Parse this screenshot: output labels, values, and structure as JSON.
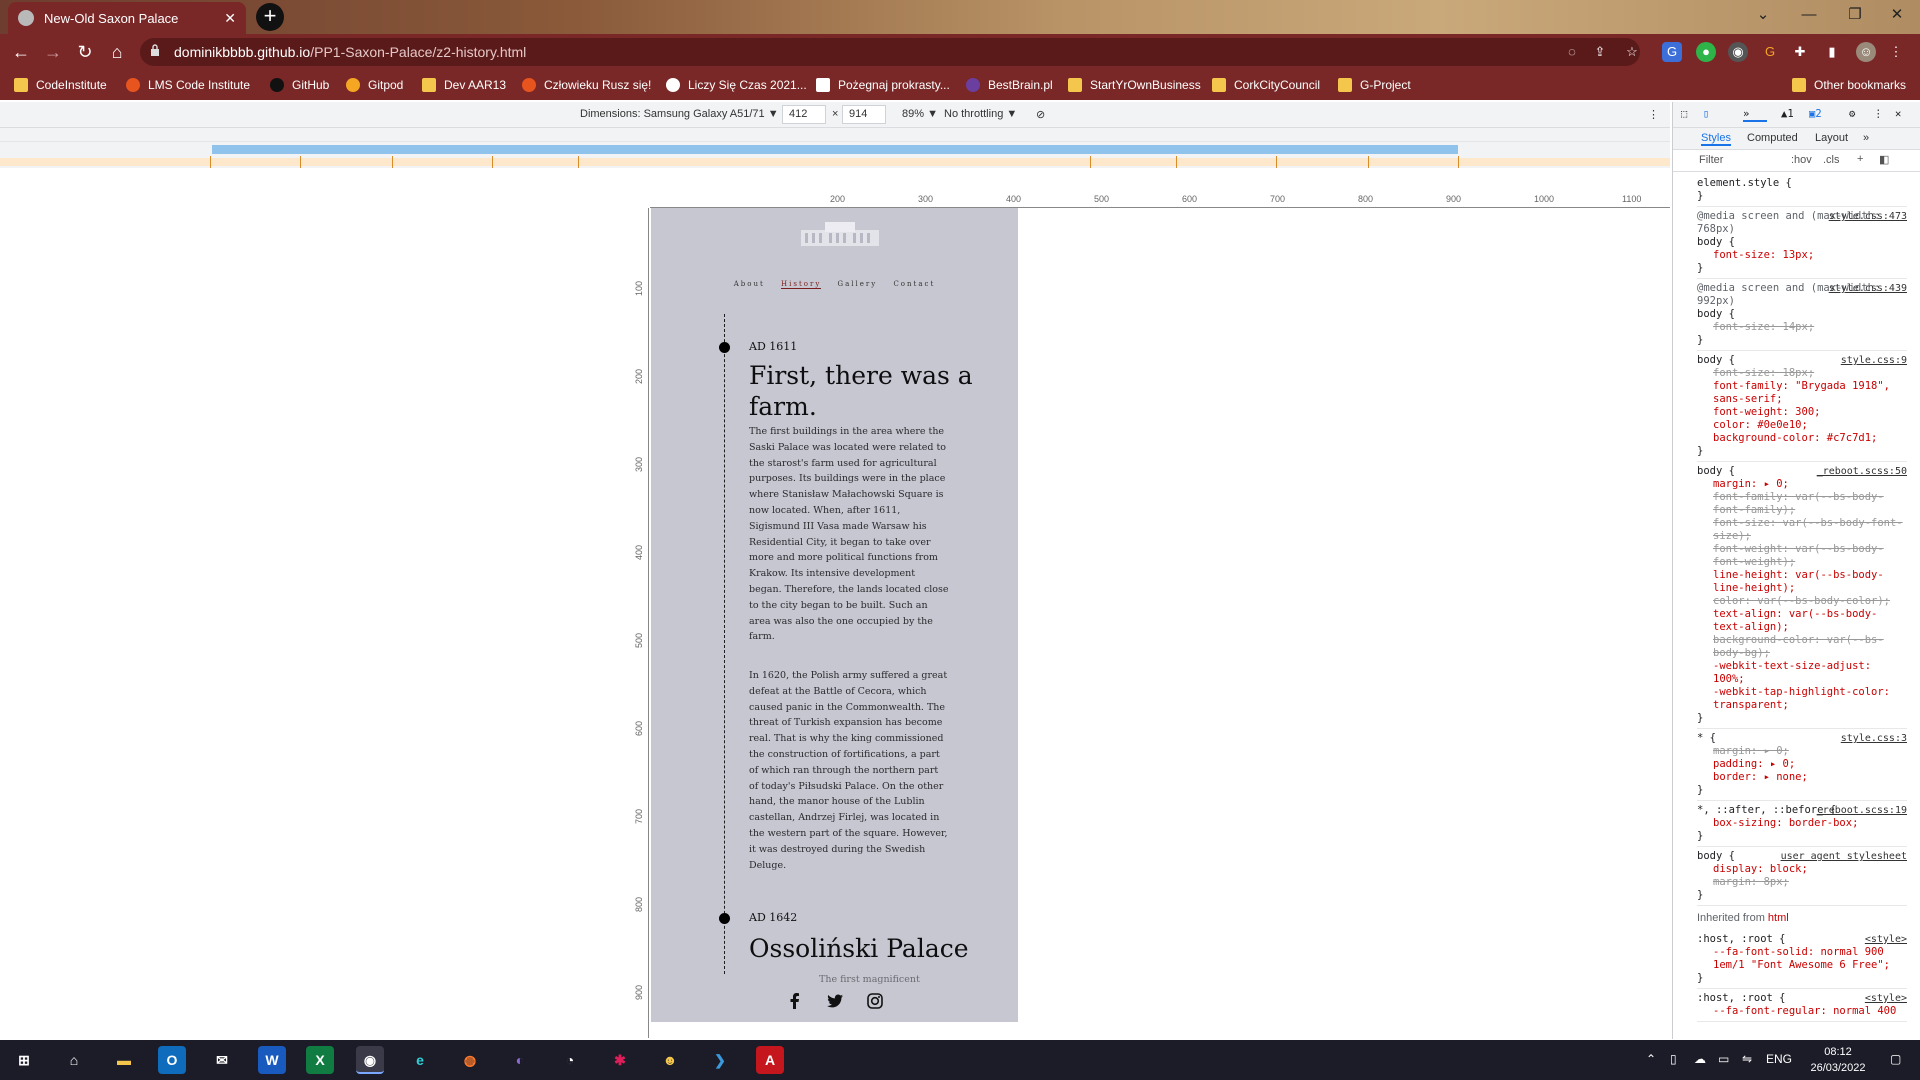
{
  "browser": {
    "tab_title": "New-Old Saxon Palace",
    "url_host": "dominikbbbb.github.io",
    "url_path": "/PP1-Saxon-Palace/z2-history.html",
    "bookmarks": [
      "CodeInstitute",
      "LMS Code Institute",
      "GitHub",
      "Gitpod",
      "Dev AAR13",
      "Człowieku Rusz się!",
      "Liczy Się Czas 2021...",
      "Pożegnaj prokrasty...",
      "BestBrain.pl",
      "StartYrOwnBusiness",
      "CorkCityCouncil",
      "G-Project"
    ],
    "other_bookmarks": "Other bookmarks"
  },
  "device_toolbar": {
    "dimensions_label": "Dimensions: Samsung Galaxy A51/71 ▼",
    "width": "412",
    "times": "×",
    "height": "914",
    "zoom": "89% ▼",
    "throttling": "No throttling ▼"
  },
  "ruler": {
    "h_marks": [
      "200",
      "300",
      "400",
      "500",
      "600",
      "700",
      "800",
      "900",
      "1000",
      "1100"
    ],
    "v_marks": [
      "100",
      "200",
      "300",
      "400",
      "500",
      "600",
      "700",
      "800",
      "900"
    ]
  },
  "site": {
    "nav": [
      "About",
      "History",
      "Gallery",
      "Contact"
    ],
    "events": [
      {
        "date": "AD 1611",
        "heading": "First, there was a farm.",
        "paragraphs": [
          "The first buildings in the area where the Saski Palace was located were related to the starost's farm used for agricultural purposes. Its buildings were in the place where Stanisław Małachowski Square is now located. When, after 1611, Sigismund III Vasa made Warsaw his Residential City, it began to take over more and more political functions from Krakow. Its intensive development began. Therefore, the lands located close to the city began to be built. Such an area was also the one occupied by the farm.",
          "In 1620, the Polish army suffered a great defeat at the Battle of Cecora, which caused panic in the Commonwealth. The threat of Turkish expansion has become real. That is why the king commissioned the construction of fortifications, a part of which ran through the northern part of today's Piłsudski Palace. On the other hand, the manor house of the Lublin castellan, Andrzej Firlej, was located in the western part of the square. However, it was destroyed during the Swedish Deluge."
        ]
      },
      {
        "date": "AD 1642",
        "heading": "Ossoliński Palace",
        "paragraphs": [
          "The first magnificent"
        ]
      }
    ],
    "social_icons": [
      "facebook-icon",
      "twitter-icon",
      "instagram-icon"
    ],
    "colors": {
      "background": "#c7c7d1",
      "text": "#0e0e10",
      "active_nav": "#7a1f1f"
    }
  },
  "devtools": {
    "tabs": [
      "Styles",
      "Computed",
      "Layout",
      "»"
    ],
    "issues_count": "1",
    "messages_count": "2",
    "filter_placeholder": "Filter",
    "filter_hov": ":hov",
    "filter_cls": ".cls",
    "rules": [
      {
        "selector": "element.style {",
        "source": "",
        "lines": [
          "}"
        ]
      },
      {
        "selector": "@media screen and (max-width: 768px)\nbody {",
        "source": "style.css:473",
        "lines": [
          "font-size: 13px;",
          "}"
        ]
      },
      {
        "selector": "@media screen and (max-width: 992px)\nbody {",
        "source": "style.css:439",
        "lines": [
          "~font-size: 14px;",
          "}"
        ]
      },
      {
        "selector": "body {",
        "source": "style.css:9",
        "lines": [
          "~font-size: 18px;",
          "font-family: \"Brygada 1918\", sans-serif;",
          "font-weight: 300;",
          "color: #0e0e10;",
          "background-color: #c7c7d1;",
          "}"
        ]
      },
      {
        "selector": "body {",
        "source": "_reboot.scss:50",
        "lines": [
          "margin: ▸ 0;",
          "~font-family: var(--bs-body-font-family);",
          "~font-size: var(--bs-body-font-size);",
          "~font-weight: var(--bs-body-font-weight);",
          "line-height: var(--bs-body-line-height);",
          "~color: var(--bs-body-color);",
          "text-align: var(--bs-body-text-align);",
          "~background-color: var(--bs-body-bg);",
          "-webkit-text-size-adjust: 100%;",
          "-webkit-tap-highlight-color: transparent;",
          "}"
        ]
      },
      {
        "selector": "* {",
        "source": "style.css:3",
        "lines": [
          "~margin: ▸ 0;",
          "padding: ▸ 0;",
          "border: ▸ none;",
          "}"
        ]
      },
      {
        "selector": "*, ::after, ::before {",
        "source": "_reboot.scss:19",
        "lines": [
          "box-sizing: border-box;",
          "}"
        ]
      },
      {
        "selector": "body {",
        "source": "user agent stylesheet",
        "lines": [
          "display: block;",
          "~margin: 8px;",
          "}"
        ]
      }
    ],
    "inherited_label": "Inherited from",
    "inherited_tag": "html",
    "root_rules": [
      {
        "selector": ":host, :root {",
        "source": "<style>",
        "lines": [
          "--fa-font-solid: normal 900 1em/1 \"Font Awesome 6 Free\";",
          "}"
        ]
      },
      {
        "selector": ":host, :root {",
        "source": "<style>",
        "lines": [
          "--fa-font-regular: normal 400"
        ]
      }
    ]
  },
  "taskbar": {
    "language": "ENG",
    "time": "08:12",
    "date": "26/03/2022"
  }
}
